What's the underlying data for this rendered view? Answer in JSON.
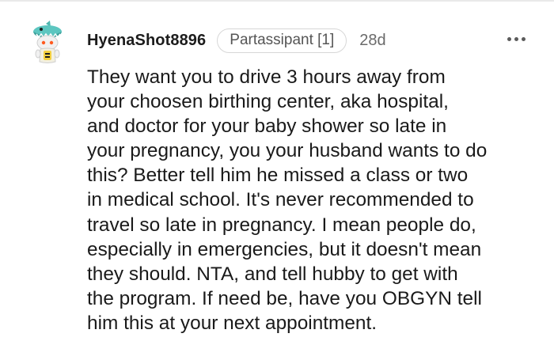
{
  "comment": {
    "username": "HyenaShot8896",
    "flair": "Partassipant [1]",
    "time": "28d",
    "more_icon": "more-options-icon",
    "avatar_icon": "snoo-avatar-icon",
    "lines": [
      "They want you to drive 3 hours away from",
      "your choosen birthing center, aka hospital,",
      "and doctor for your baby shower so late in",
      "your pregnancy, you your husband wants to do",
      "this? Better tell him he missed a class or two",
      "in medical school. It's never recommended to",
      "travel so late in pregnancy. I mean people do,",
      "especially in emergencies, but it doesn't mean",
      "they should. NTA, and tell hubby to get with",
      "the program. If need be, have you OBGYN tell",
      "him this at your next appointment."
    ]
  }
}
